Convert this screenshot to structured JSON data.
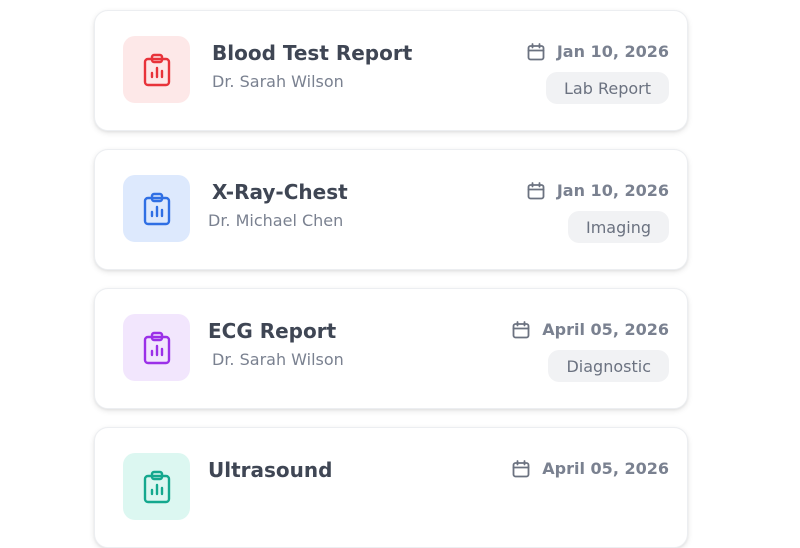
{
  "reports": [
    {
      "title": "Blood Test Report",
      "doctor": "Dr. Sarah Wilson",
      "date": "Jan 10, 2026",
      "category": "Lab Report",
      "icon": "clipboard-chart-icon",
      "icon_color": "#e8333a",
      "icon_bg": "#fde8e8"
    },
    {
      "title": "X-Ray-Chest",
      "doctor": "Dr. Michael Chen",
      "date": "Jan 10, 2026",
      "category": "Imaging",
      "icon": "clipboard-chart-icon",
      "icon_color": "#2f6fe4",
      "icon_bg": "#dde9fd"
    },
    {
      "title": "ECG Report",
      "doctor": "Dr. Sarah Wilson",
      "date": "April 05, 2026",
      "category": "Diagnostic",
      "icon": "clipboard-chart-icon",
      "icon_color": "#9b30e8",
      "icon_bg": "#f2e6fd"
    },
    {
      "title": "Ultrasound",
      "doctor": "",
      "date": "April 05, 2026",
      "category": "",
      "icon": "clipboard-chart-icon",
      "icon_color": "#14a88e",
      "icon_bg": "#dcf7f1"
    }
  ]
}
